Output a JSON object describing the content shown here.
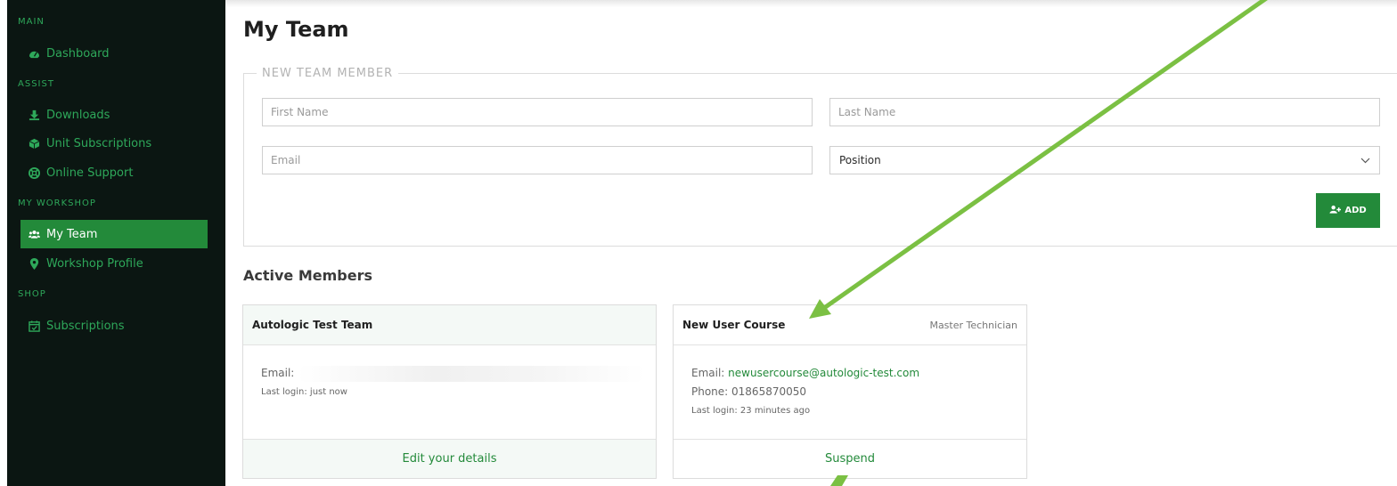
{
  "sidebar": {
    "sections": {
      "main": "MAIN",
      "assist": "ASSIST",
      "workshop": "MY WORKSHOP",
      "shop": "SHOP"
    },
    "items": [
      {
        "label": "Dashboard",
        "icon": "dashboard-icon"
      },
      {
        "label": "Downloads",
        "icon": "download-icon"
      },
      {
        "label": "Unit Subscriptions",
        "icon": "cube-icon"
      },
      {
        "label": "Online Support",
        "icon": "lifebuoy-icon"
      },
      {
        "label": "My Team",
        "icon": "users-icon",
        "active": true
      },
      {
        "label": "Workshop Profile",
        "icon": "map-marker-icon"
      },
      {
        "label": "Subscriptions",
        "icon": "calendar-check-icon"
      }
    ]
  },
  "page": {
    "title": "My Team"
  },
  "form": {
    "legend": "NEW TEAM MEMBER",
    "first_name_placeholder": "First Name",
    "last_name_placeholder": "Last Name",
    "email_placeholder": "Email",
    "position_value": "Position",
    "add_label": "ADD"
  },
  "members": {
    "title": "Active Members",
    "cards": [
      {
        "name": "Autologic Test Team",
        "role": "",
        "email_label": "Email:",
        "last_login": "Last login: just now",
        "action": "Edit your details"
      },
      {
        "name": "New User Course",
        "role": "Master Technician",
        "email_label": "Email:",
        "email": "newusercourse@autologic-test.com",
        "phone": "Phone: 01865870050",
        "last_login": "Last login: 23 minutes ago",
        "action": "Suspend"
      }
    ]
  },
  "colors": {
    "accent": "#238a3a",
    "sidebar_bg": "#0b1612",
    "nav_text": "#2ea85a",
    "annotation_arrow": "#7bc043"
  }
}
